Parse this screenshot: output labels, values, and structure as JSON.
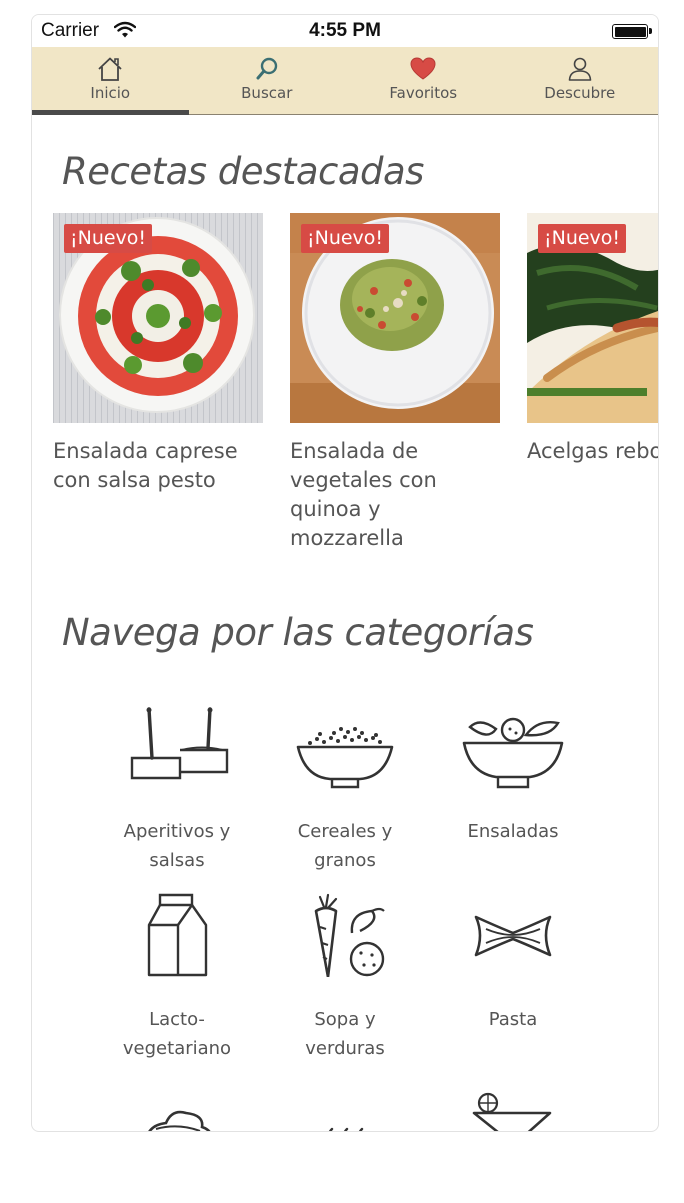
{
  "status_bar": {
    "carrier": "Carrier",
    "time": "4:55 PM"
  },
  "tabs": [
    {
      "label": "Inicio",
      "icon": "home-icon",
      "active": true
    },
    {
      "label": "Buscar",
      "icon": "search-icon",
      "active": false
    },
    {
      "label": "Favoritos",
      "icon": "heart-icon",
      "active": false
    },
    {
      "label": "Descubre",
      "icon": "person-icon",
      "active": false
    }
  ],
  "featured": {
    "title": "Recetas destacadas",
    "cards": [
      {
        "badge": "¡Nuevo!",
        "title": "Ensalada caprese con salsa pesto"
      },
      {
        "badge": "¡Nuevo!",
        "title": "Ensalada de vegetales con quinoa y mozzarella"
      },
      {
        "badge": "¡Nuevo!",
        "title": "Acelgas rebo con salsa de"
      }
    ]
  },
  "categories": {
    "title": "Navega por las categorías",
    "items": [
      {
        "label": "Aperitivos y salsas",
        "icon": "skewers-icon"
      },
      {
        "label": "Cereales y granos",
        "icon": "grain-bowl-icon"
      },
      {
        "label": "Ensaladas",
        "icon": "salad-bowl-icon"
      },
      {
        "label": "Lacto-vegetariano",
        "icon": "milk-carton-icon"
      },
      {
        "label": "Sopa y verduras",
        "icon": "vegetables-icon"
      },
      {
        "label": "Pasta",
        "icon": "bowtie-pasta-icon"
      },
      {
        "label": "",
        "icon": "dessert-icon"
      },
      {
        "label": "",
        "icon": "steam-icon"
      },
      {
        "label": "",
        "icon": "cocktail-icon"
      }
    ]
  },
  "colors": {
    "tab_bar_bg": "#f1e6c6",
    "badge_bg": "#d74b45",
    "heart": "#d74b45",
    "search_icon": "#3b6f73"
  }
}
